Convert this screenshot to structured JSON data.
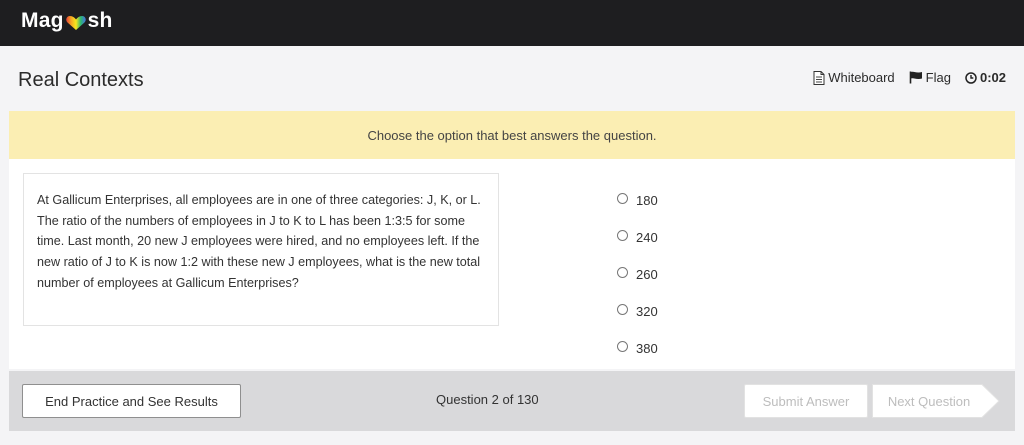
{
  "app": {
    "logo_text_left": "Mag",
    "logo_text_right": "sh"
  },
  "header": {
    "title": "Real Contexts",
    "whiteboard_label": "Whiteboard",
    "flag_label": "Flag",
    "timer": "0:02"
  },
  "instruction": "Choose the option that best answers the question.",
  "question": {
    "text": "At Gallicum Enterprises, all employees are in one of three categories: J, K, or L.  The ratio of the numbers of employees in J to K to L has been 1:3:5 for some time.  Last month, 20 new J employees were hired, and no employees left.  If the new ratio of J to K is now 1:2 with these new J employees, what is the new total number of employees at Gallicum Enterprises?"
  },
  "options": [
    "180",
    "240",
    "260",
    "320",
    "380"
  ],
  "footer": {
    "end_label": "End Practice and See Results",
    "progress": "Question 2 of 130",
    "submit_label": "Submit Answer",
    "next_label": "Next Question"
  },
  "colors": {
    "topbar": "#1e1e20",
    "banner": "#fbeeb3",
    "footer": "#d9d9db",
    "disabled_text": "#bdbdbd"
  }
}
